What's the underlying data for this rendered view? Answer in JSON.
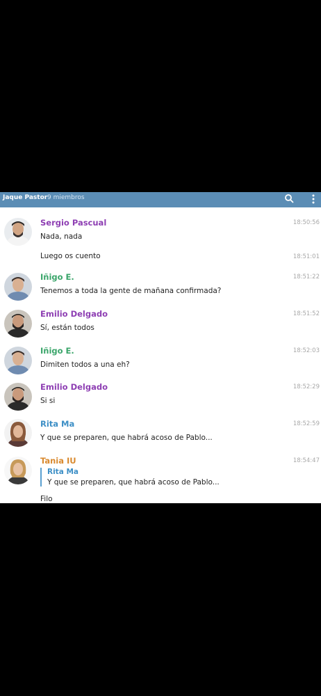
{
  "header": {
    "title": "Jaque Pastor",
    "members": "9 miembros"
  },
  "icons": {
    "search": "search-icon",
    "more": "more-vertical-icon"
  },
  "colors": {
    "header_bg": "#5b8db5",
    "purple": "#8e3fb3",
    "green": "#3aa56a",
    "blue": "#3d8fc6",
    "orange": "#d98a2f"
  },
  "messages": [
    {
      "sender": "Sergio Pascual",
      "text": "Nada, nada",
      "time": "18:50:56"
    },
    {
      "text": "Luego os cuento",
      "time": "18:51:01"
    },
    {
      "sender": "Iñigo E.",
      "text": "Tenemos a toda la gente de mañana confirmada?",
      "time": "18:51:22"
    },
    {
      "sender": "Emilio Delgado",
      "text": "Sí, están todos",
      "time": "18:51:52"
    },
    {
      "sender": "Iñigo E.",
      "text": "Dimiten todos a una eh?",
      "time": "18:52:03"
    },
    {
      "sender": "Emilio Delgado",
      "text": "Si si",
      "time": "18:52:29"
    },
    {
      "sender": "Rita Ma",
      "text": "Y que se preparen, que habrá acoso de Pablo...",
      "time": "18:52:59"
    },
    {
      "sender": "Tania IU",
      "quote_sender": "Rita Ma",
      "quote_text": "Y que se preparen, que habrá acoso de Pablo...",
      "text": "Filo",
      "time": "18:54:47"
    }
  ]
}
